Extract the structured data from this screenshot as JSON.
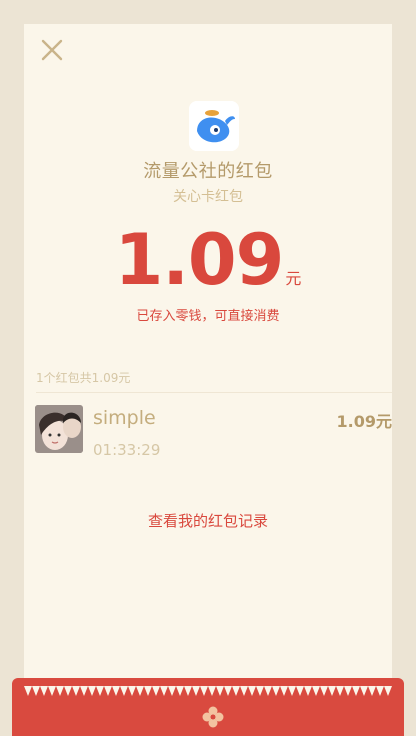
{
  "header": {
    "title": "流量公社的红包",
    "subtitle": "关心卡红包"
  },
  "amount": {
    "value": "1.09",
    "unit": "元",
    "note": "已存入零钱，可直接消费"
  },
  "summary": "1个红包共1.09元",
  "records": [
    {
      "name": "simple",
      "time": "01:33:29",
      "amount": "1.09元"
    }
  ],
  "footer": {
    "link_label": "查看我的红包记录"
  },
  "icons": {
    "close": "close-icon",
    "logo": "whale-logo-icon",
    "avatar": "user-avatar",
    "seal": "flower-icon"
  },
  "colors": {
    "page_bg": "#ece4d4",
    "card_bg": "#fbf6ea",
    "accent_red": "#d9483d",
    "gold_text": "#b49a6a",
    "muted_text": "#d6c7a6"
  }
}
